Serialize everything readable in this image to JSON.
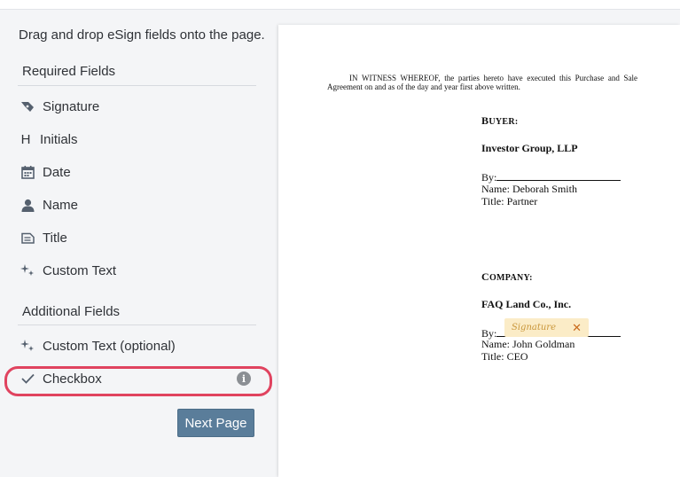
{
  "sidebar": {
    "instructions": "Drag and drop eSign fields onto the page.",
    "required_title": "Required Fields",
    "required": [
      {
        "label": "Signature",
        "icon": "pen-nib-icon"
      },
      {
        "label": "Initials",
        "icon": "h-letter-icon"
      },
      {
        "label": "Date",
        "icon": "calendar-icon"
      },
      {
        "label": "Name",
        "icon": "person-icon"
      },
      {
        "label": "Title",
        "icon": "id-card-icon"
      },
      {
        "label": "Custom Text",
        "icon": "sparkle-icon"
      }
    ],
    "additional_title": "Additional Fields",
    "additional": [
      {
        "label": "Custom Text (optional)",
        "icon": "sparkle-icon"
      },
      {
        "label": "Checkbox",
        "icon": "checkmark-icon",
        "highlighted": true
      }
    ],
    "info_icon": "info-icon",
    "initials_glyph": "H",
    "next_label": "Next Page",
    "colors": {
      "highlight": "#e0435f",
      "button": "#5a7d9a",
      "signature_tag": "#fbecc7"
    }
  },
  "document": {
    "witness_paragraph": "IN WITNESS WHEREOF, the parties hereto have executed this Purchase and Sale Agreement on and as of the day and year first above written.",
    "buyer": {
      "heading_first": "B",
      "heading_rest": "UYER:",
      "party": "Investor Group, LLP",
      "by": "By:",
      "name": "Name: Deborah Smith",
      "title": "Title: Partner"
    },
    "company": {
      "heading_first": "C",
      "heading_rest": "OMPANY:",
      "party": "FAQ Land Co., Inc.",
      "by": "By:",
      "name": "Name: John Goldman",
      "title": "Title: CEO"
    },
    "signature_tag": {
      "label": "Signature",
      "close": "✕"
    }
  }
}
